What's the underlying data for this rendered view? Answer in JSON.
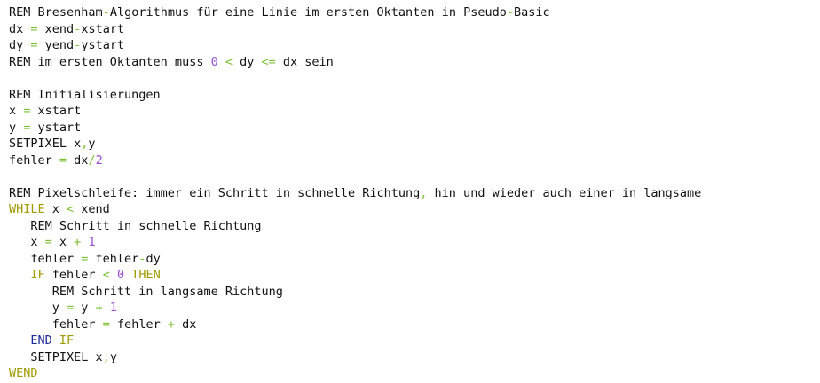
{
  "colors": {
    "background": "#ffffff",
    "text": "#111111",
    "operator": "#7cc132",
    "number": "#9b4fd6",
    "keyword": "#a09a00",
    "keyword_end": "#1b2a99"
  },
  "code": {
    "lines": [
      [
        {
          "t": "REM Bresenham"
        },
        {
          "t": "-",
          "c": "op"
        },
        {
          "t": "Algorithmus für eine Linie im ersten Oktanten in Pseudo"
        },
        {
          "t": "-",
          "c": "op"
        },
        {
          "t": "Basic"
        }
      ],
      [
        {
          "t": "dx "
        },
        {
          "t": "=",
          "c": "op"
        },
        {
          "t": " xend"
        },
        {
          "t": "-",
          "c": "op"
        },
        {
          "t": "xstart"
        }
      ],
      [
        {
          "t": "dy "
        },
        {
          "t": "=",
          "c": "op"
        },
        {
          "t": " yend"
        },
        {
          "t": "-",
          "c": "op"
        },
        {
          "t": "ystart"
        }
      ],
      [
        {
          "t": "REM im ersten Oktanten muss "
        },
        {
          "t": "0",
          "c": "num"
        },
        {
          "t": " "
        },
        {
          "t": "<",
          "c": "op"
        },
        {
          "t": " dy "
        },
        {
          "t": "<=",
          "c": "op"
        },
        {
          "t": " dx sein"
        }
      ],
      [],
      [
        {
          "t": "REM Initialisierungen"
        }
      ],
      [
        {
          "t": "x "
        },
        {
          "t": "=",
          "c": "op"
        },
        {
          "t": " xstart"
        }
      ],
      [
        {
          "t": "y "
        },
        {
          "t": "=",
          "c": "op"
        },
        {
          "t": " ystart"
        }
      ],
      [
        {
          "t": "SETPIXEL x"
        },
        {
          "t": ",",
          "c": "op"
        },
        {
          "t": "y"
        }
      ],
      [
        {
          "t": "fehler "
        },
        {
          "t": "=",
          "c": "op"
        },
        {
          "t": " dx"
        },
        {
          "t": "/",
          "c": "op"
        },
        {
          "t": "2",
          "c": "num"
        }
      ],
      [],
      [
        {
          "t": "REM Pixelschleife: immer ein Schritt in schnelle Richtung"
        },
        {
          "t": ",",
          "c": "op"
        },
        {
          "t": " hin und wieder auch einer in langsame"
        }
      ],
      [
        {
          "t": "WHILE",
          "c": "kw"
        },
        {
          "t": " x "
        },
        {
          "t": "<",
          "c": "op"
        },
        {
          "t": " xend"
        }
      ],
      [
        {
          "t": "   REM Schritt in schnelle Richtung"
        }
      ],
      [
        {
          "t": "   x "
        },
        {
          "t": "=",
          "c": "op"
        },
        {
          "t": " x "
        },
        {
          "t": "+",
          "c": "op"
        },
        {
          "t": " "
        },
        {
          "t": "1",
          "c": "num"
        }
      ],
      [
        {
          "t": "   fehler "
        },
        {
          "t": "=",
          "c": "op"
        },
        {
          "t": " fehler"
        },
        {
          "t": "-",
          "c": "op"
        },
        {
          "t": "dy"
        }
      ],
      [
        {
          "t": "   "
        },
        {
          "t": "IF",
          "c": "kw"
        },
        {
          "t": " fehler "
        },
        {
          "t": "<",
          "c": "op"
        },
        {
          "t": " "
        },
        {
          "t": "0",
          "c": "num"
        },
        {
          "t": " "
        },
        {
          "t": "THEN",
          "c": "kw"
        }
      ],
      [
        {
          "t": "      REM Schritt in langsame Richtung"
        }
      ],
      [
        {
          "t": "      y "
        },
        {
          "t": "=",
          "c": "op"
        },
        {
          "t": " y "
        },
        {
          "t": "+",
          "c": "op"
        },
        {
          "t": " "
        },
        {
          "t": "1",
          "c": "num"
        }
      ],
      [
        {
          "t": "      fehler "
        },
        {
          "t": "=",
          "c": "op"
        },
        {
          "t": " fehler "
        },
        {
          "t": "+",
          "c": "op"
        },
        {
          "t": " dx"
        }
      ],
      [
        {
          "t": "   "
        },
        {
          "t": "END",
          "c": "kw2"
        },
        {
          "t": " "
        },
        {
          "t": "IF",
          "c": "kw"
        }
      ],
      [
        {
          "t": "   SETPIXEL x"
        },
        {
          "t": ",",
          "c": "op"
        },
        {
          "t": "y"
        }
      ],
      [
        {
          "t": "WEND",
          "c": "kw"
        }
      ]
    ]
  }
}
